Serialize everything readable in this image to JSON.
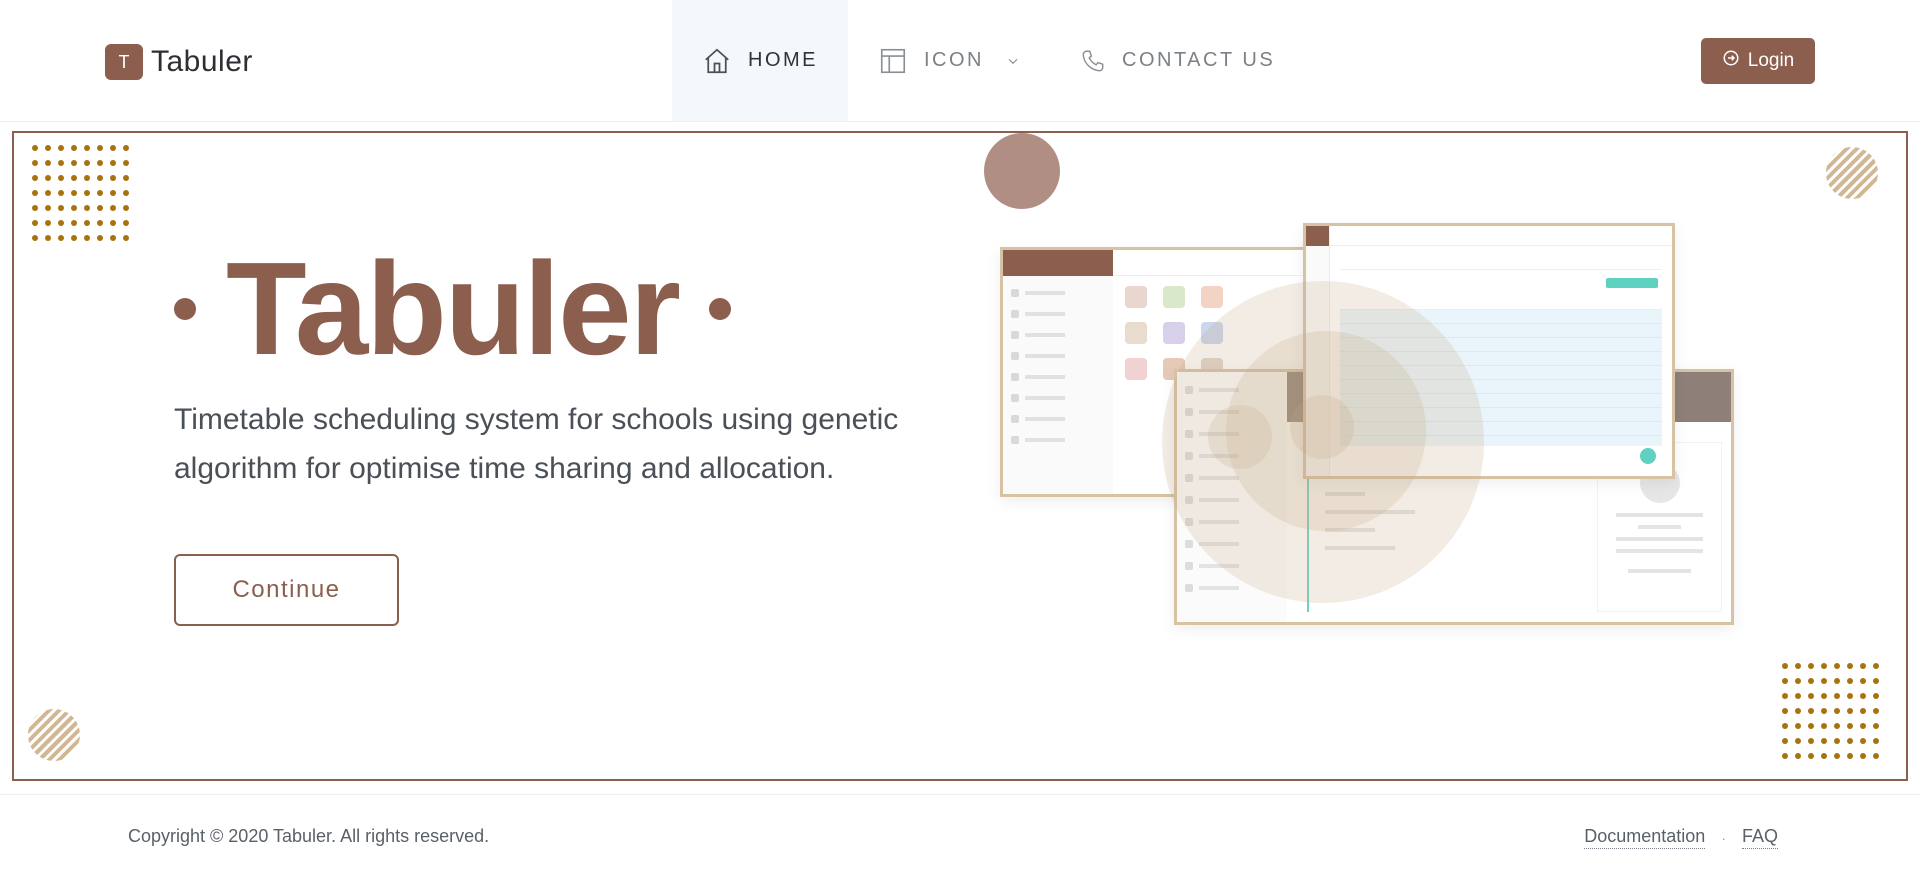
{
  "brand": {
    "logo_letter": "T",
    "name": "Tabuler"
  },
  "nav": {
    "items": [
      {
        "label": "HOME",
        "icon": "home-icon",
        "active": true
      },
      {
        "label": "ICON",
        "icon": "layout-icon",
        "has_dropdown": true
      },
      {
        "label": "CONTACT US",
        "icon": "phone-icon"
      }
    ]
  },
  "login": {
    "label": "Login",
    "icon": "login-icon"
  },
  "hero": {
    "title": "Tabuler",
    "subtitle": "Timetable scheduling system for schools using genetic algorithm for optimise time sharing and allocation.",
    "cta_label": "Continue"
  },
  "footer": {
    "copyright": "Copyright © 2020 Tabuler. All rights reserved.",
    "links": [
      "Documentation",
      "FAQ"
    ],
    "separator": "·"
  },
  "colors": {
    "brand": "#8b5e4e",
    "dots": "#a8730f",
    "hatch": "#d2b795",
    "accent_teal": "#5ed1c0"
  }
}
